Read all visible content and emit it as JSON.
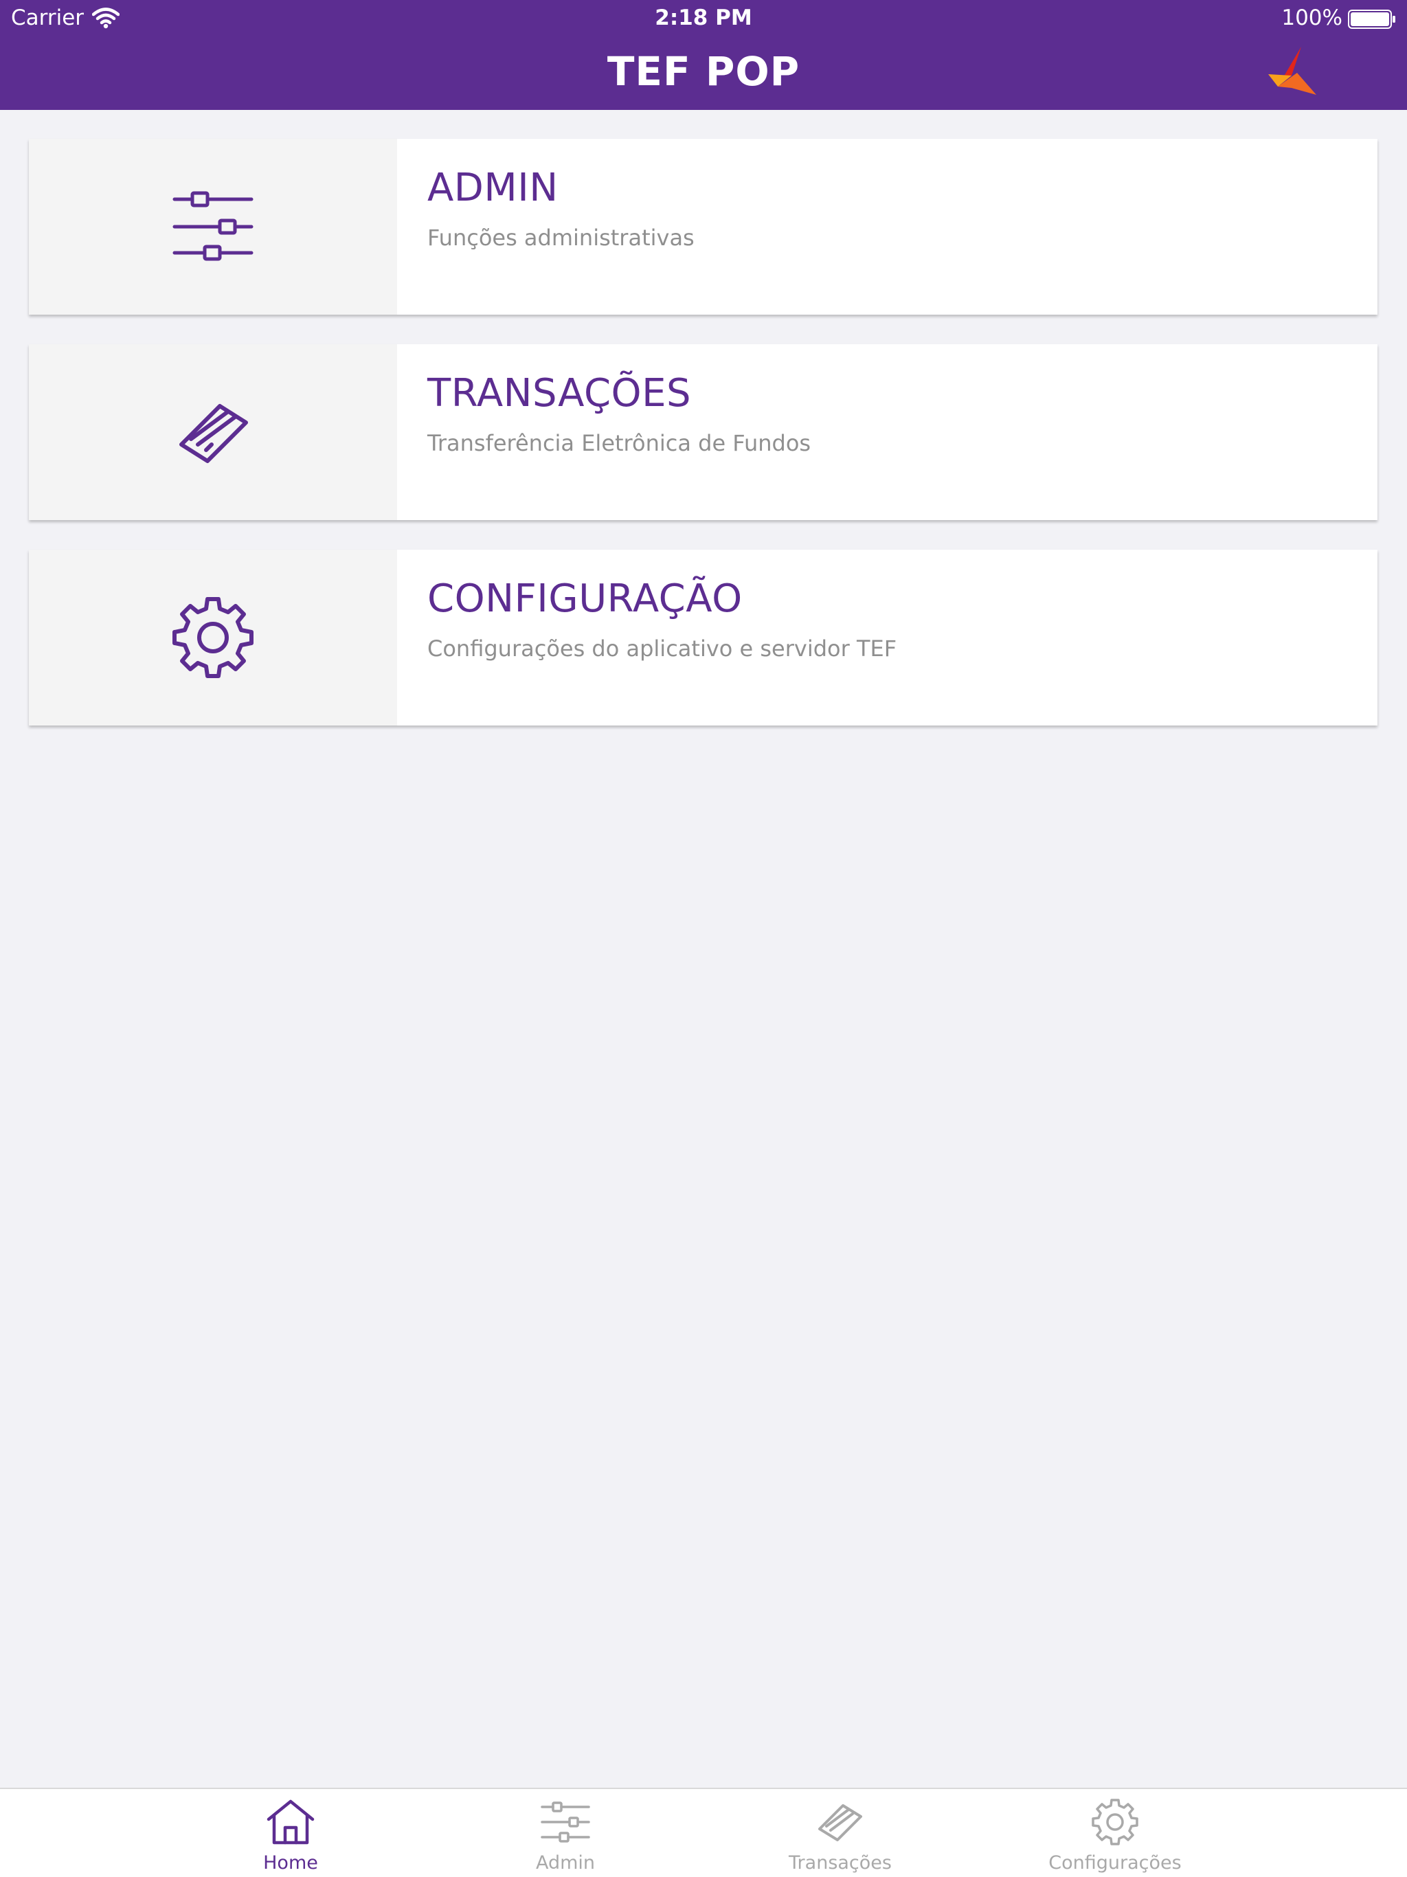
{
  "status_bar": {
    "carrier": "Carrier",
    "time": "2:18 PM",
    "battery": "100%"
  },
  "header": {
    "title": "TEF POP",
    "logo_icon": "tef-pop-logo-icon"
  },
  "menu": [
    {
      "title": "ADMIN",
      "subtitle": "Funções administrativas",
      "icon": "sliders-icon"
    },
    {
      "title": "TRANSAÇÕES",
      "subtitle": "Transferência Eletrônica de Fundos",
      "icon": "card-icon"
    },
    {
      "title": "CONFIGURAÇÃO",
      "subtitle": "Configurações do aplicativo e servidor TEF",
      "icon": "gear-icon"
    }
  ],
  "tab_bar": {
    "items": [
      {
        "label": "Home",
        "icon": "home-icon",
        "active": true
      },
      {
        "label": "Admin",
        "icon": "sliders-icon",
        "active": false
      },
      {
        "label": "Transações",
        "icon": "card-icon",
        "active": false
      },
      {
        "label": "Configurações",
        "icon": "gear-icon",
        "active": false
      }
    ]
  },
  "colors": {
    "brand_purple": "#5c2d91",
    "background": "#f2f2f6",
    "icon_panel": "#f4f4f4",
    "subtitle_gray": "#8f8f8f",
    "inactive_tab": "#a9a9a9",
    "logo_orange": "#f26a21",
    "logo_red": "#e1251b"
  }
}
